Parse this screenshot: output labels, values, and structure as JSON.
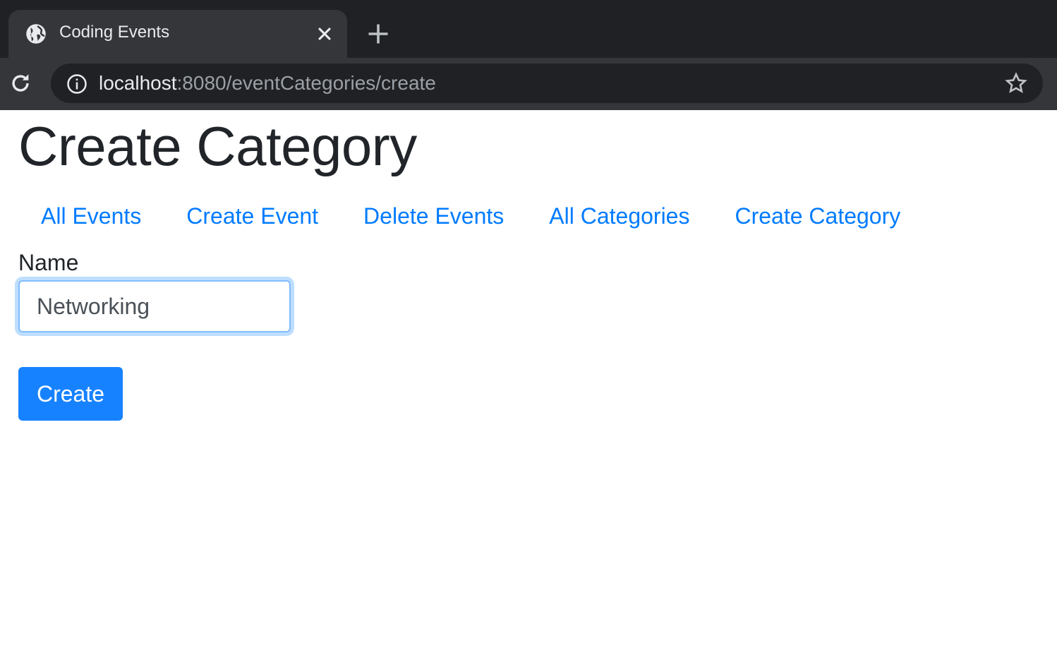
{
  "browser": {
    "tab_title": "Coding Events",
    "url_host": "localhost",
    "url_rest": ":8080/eventCategories/create",
    "icons": {
      "tab_favicon": "globe-icon",
      "tab_close": "close-icon",
      "new_tab": "plus-icon",
      "reload": "reload-icon",
      "site_info": "info-icon",
      "bookmark": "star-icon"
    }
  },
  "page": {
    "title": "Create Category",
    "nav": [
      {
        "label": "All Events"
      },
      {
        "label": "Create Event"
      },
      {
        "label": "Delete Events"
      },
      {
        "label": "All Categories"
      },
      {
        "label": "Create Category"
      }
    ],
    "form": {
      "name_label": "Name",
      "name_value": "Networking",
      "submit_label": "Create"
    }
  },
  "colors": {
    "link": "#007bff",
    "button": "#1782ff",
    "heading": "#212529"
  }
}
